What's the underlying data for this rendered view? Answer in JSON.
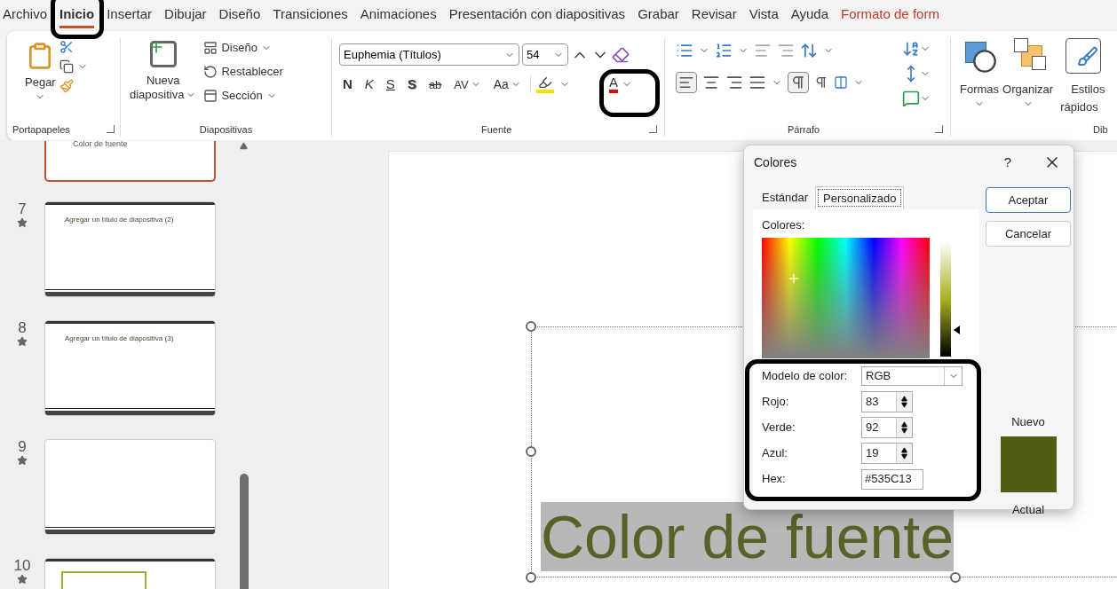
{
  "menu_tabs": [
    {
      "label": "Archivo",
      "selected": false,
      "kind": "normal"
    },
    {
      "label": "Inicio",
      "selected": true,
      "kind": "normal"
    },
    {
      "label": "Insertar",
      "selected": false,
      "kind": "normal"
    },
    {
      "label": "Dibujar",
      "selected": false,
      "kind": "normal"
    },
    {
      "label": "Diseño",
      "selected": false,
      "kind": "normal"
    },
    {
      "label": "Transiciones",
      "selected": false,
      "kind": "normal"
    },
    {
      "label": "Animaciones",
      "selected": false,
      "kind": "normal"
    },
    {
      "label": "Presentación con diapositivas",
      "selected": false,
      "kind": "normal"
    },
    {
      "label": "Grabar",
      "selected": false,
      "kind": "normal"
    },
    {
      "label": "Revisar",
      "selected": false,
      "kind": "normal"
    },
    {
      "label": "Vista",
      "selected": false,
      "kind": "normal"
    },
    {
      "label": "Ayuda",
      "selected": false,
      "kind": "normal"
    },
    {
      "label": "Formato de form",
      "selected": false,
      "kind": "contextual"
    }
  ],
  "ribbon": {
    "clipboard": {
      "label": "Portapapeles",
      "paste": "Pegar"
    },
    "slides": {
      "label": "Diapositivas",
      "new_slide": "Nueva",
      "new_slide_2": "diapositiva",
      "items": [
        "Diseño",
        "Restablecer",
        "Sección"
      ]
    },
    "font": {
      "label": "Fuente",
      "font_name": "Euphemia (Títulos)",
      "font_size": "54",
      "bold": "N",
      "italic": "K",
      "underline": "S",
      "shadow": "S",
      "strike": "ab",
      "spacing": "AV",
      "case": "Aa",
      "color_letter": "A"
    },
    "paragraph": {
      "label": "Párrafo"
    },
    "drawing": {
      "label": "Dib",
      "items": [
        "Formas",
        "Organizar"
      ],
      "styles": "Estilos",
      "styles_2": "rápidos"
    }
  },
  "thumbnails": [
    {
      "title": "Color de fuente",
      "selected": true,
      "kind": "title"
    },
    {
      "number": "7",
      "title": "Agregar un título de diapositiva (2)",
      "selected": false,
      "kind": "title"
    },
    {
      "number": "8",
      "title": "Agregar un título de diapositiva (3)",
      "selected": false,
      "kind": "title"
    },
    {
      "number": "9",
      "selected": false,
      "kind": "blank"
    },
    {
      "number": "10",
      "selected": false,
      "kind": "boxes"
    }
  ],
  "slide": {
    "title": "Color de fuente"
  },
  "dialog": {
    "title": "Colores",
    "help": "?",
    "tabs": [
      {
        "label": "Estándar",
        "selected": false
      },
      {
        "label": "Personalizado",
        "selected": true
      }
    ],
    "colors_label": "Colores:",
    "luminance": {
      "level": 0.23
    },
    "model_label": "Modelo de color:",
    "model": "RGB",
    "fields": [
      {
        "label": "Rojo:",
        "value": "83"
      },
      {
        "label": "Verde:",
        "value": "92"
      },
      {
        "label": "Azul:",
        "value": "19"
      }
    ],
    "hex_label": "Hex:",
    "hex": "#535C13",
    "buttons": [
      "Aceptar",
      "Cancelar"
    ],
    "new_label": "Nuevo",
    "current_label": "Actual"
  }
}
